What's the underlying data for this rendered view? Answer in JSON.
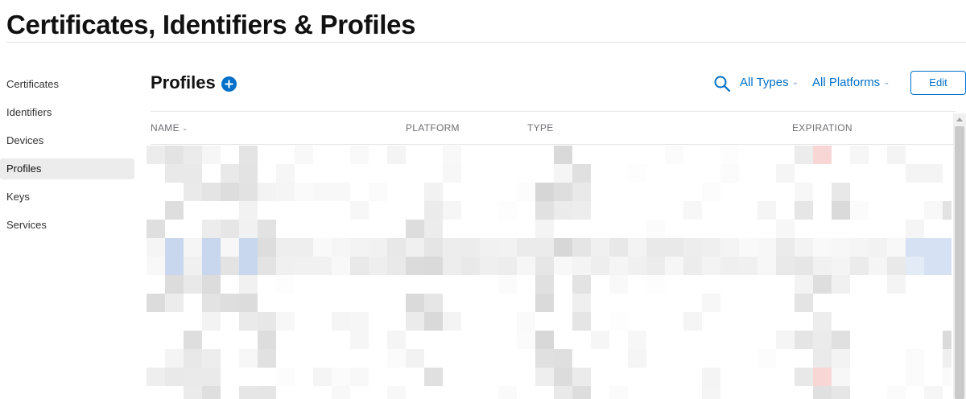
{
  "page": {
    "title": "Certificates, Identifiers & Profiles"
  },
  "sidebar": {
    "items": [
      {
        "label": "Certificates",
        "active": false
      },
      {
        "label": "Identifiers",
        "active": false
      },
      {
        "label": "Devices",
        "active": false
      },
      {
        "label": "Profiles",
        "active": true
      },
      {
        "label": "Keys",
        "active": false
      },
      {
        "label": "Services",
        "active": false
      }
    ]
  },
  "section": {
    "title": "Profiles",
    "add_icon": "plus-circle-icon"
  },
  "toolbar": {
    "search_icon": "search-icon",
    "filter_types": "All Types",
    "filter_platforms": "All Platforms",
    "edit_label": "Edit"
  },
  "table": {
    "columns": [
      "NAME",
      "PLATFORM",
      "TYPE",
      "EXPIRATION"
    ],
    "sort_column": "NAME",
    "rows_obscured": true
  },
  "colors": {
    "accent": "#0070c9",
    "text": "#111111",
    "muted": "#6e6e73",
    "sidebar_active_bg": "#ececec"
  }
}
